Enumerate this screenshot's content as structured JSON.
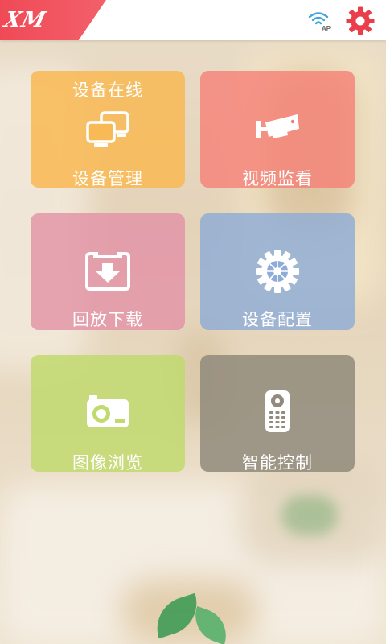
{
  "app": {
    "logo_text": "XM"
  },
  "header": {
    "wifi_label": "AP",
    "icons": [
      "wifi-ap-icon",
      "gear-icon"
    ],
    "accent_color": "#f04a56"
  },
  "tiles": [
    {
      "status": "设备在线",
      "label": "设备管理",
      "icon": "monitors-icon",
      "color": "#f8ba56"
    },
    {
      "label": "视频监看",
      "icon": "security-camera-icon",
      "color": "#f67e74"
    },
    {
      "label": "回放下载",
      "icon": "download-tray-icon",
      "color": "#e292a6"
    },
    {
      "label": "设备配置",
      "icon": "gear-icon",
      "color": "#8eacd6"
    },
    {
      "label": "图像浏览",
      "icon": "camera-icon",
      "color": "#c0da6e"
    },
    {
      "label": "智能控制",
      "icon": "remote-control-icon",
      "color": "#928a7c"
    }
  ]
}
